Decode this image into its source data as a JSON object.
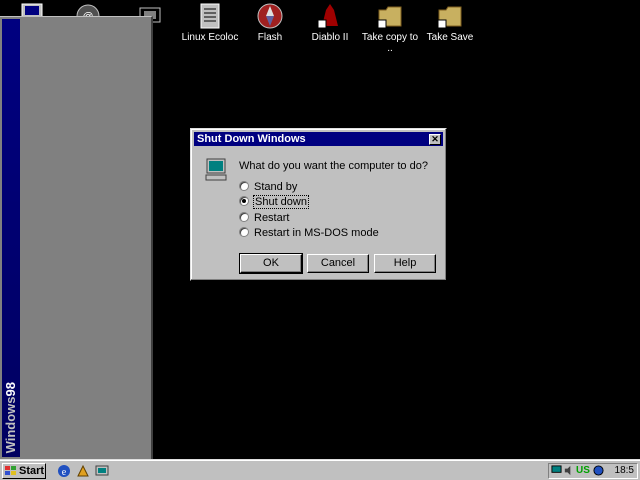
{
  "desktop": {
    "icons": [
      {
        "label": "",
        "name": "my-computer-icon"
      },
      {
        "label": "",
        "name": "opera-icon"
      },
      {
        "label": "",
        "name": "media-icon"
      },
      {
        "label": "Linux Ecoloc",
        "name": "document-icon"
      },
      {
        "label": "Flash",
        "name": "flash-icon"
      },
      {
        "label": "Diablo II",
        "name": "diablo-icon"
      },
      {
        "label": "Take copy to ..",
        "name": "folder-icon"
      },
      {
        "label": "Take Save",
        "name": "folder-icon"
      }
    ]
  },
  "start_menu": {
    "brand_prefix": "Windows",
    "brand_suffix": "98"
  },
  "dialog": {
    "title": "Shut Down Windows",
    "close_glyph": "✕",
    "question": "What do you want the computer to do?",
    "options": [
      {
        "label": "Stand by",
        "selected": false
      },
      {
        "label": "Shut down",
        "selected": true
      },
      {
        "label": "Restart",
        "selected": false
      },
      {
        "label": "Restart in MS-DOS mode",
        "selected": false
      }
    ],
    "buttons": {
      "ok": "OK",
      "cancel": "Cancel",
      "help": "Help"
    }
  },
  "taskbar": {
    "start_label": "Start",
    "quick_launch": [
      "internet-explorer-icon",
      "channel-icon",
      "desktop-icon"
    ],
    "tray": {
      "language": "US",
      "clock": "18:5"
    }
  },
  "colors": {
    "desktop": "#000000",
    "titlebar": "#000080",
    "face": "#c0c0c0"
  }
}
